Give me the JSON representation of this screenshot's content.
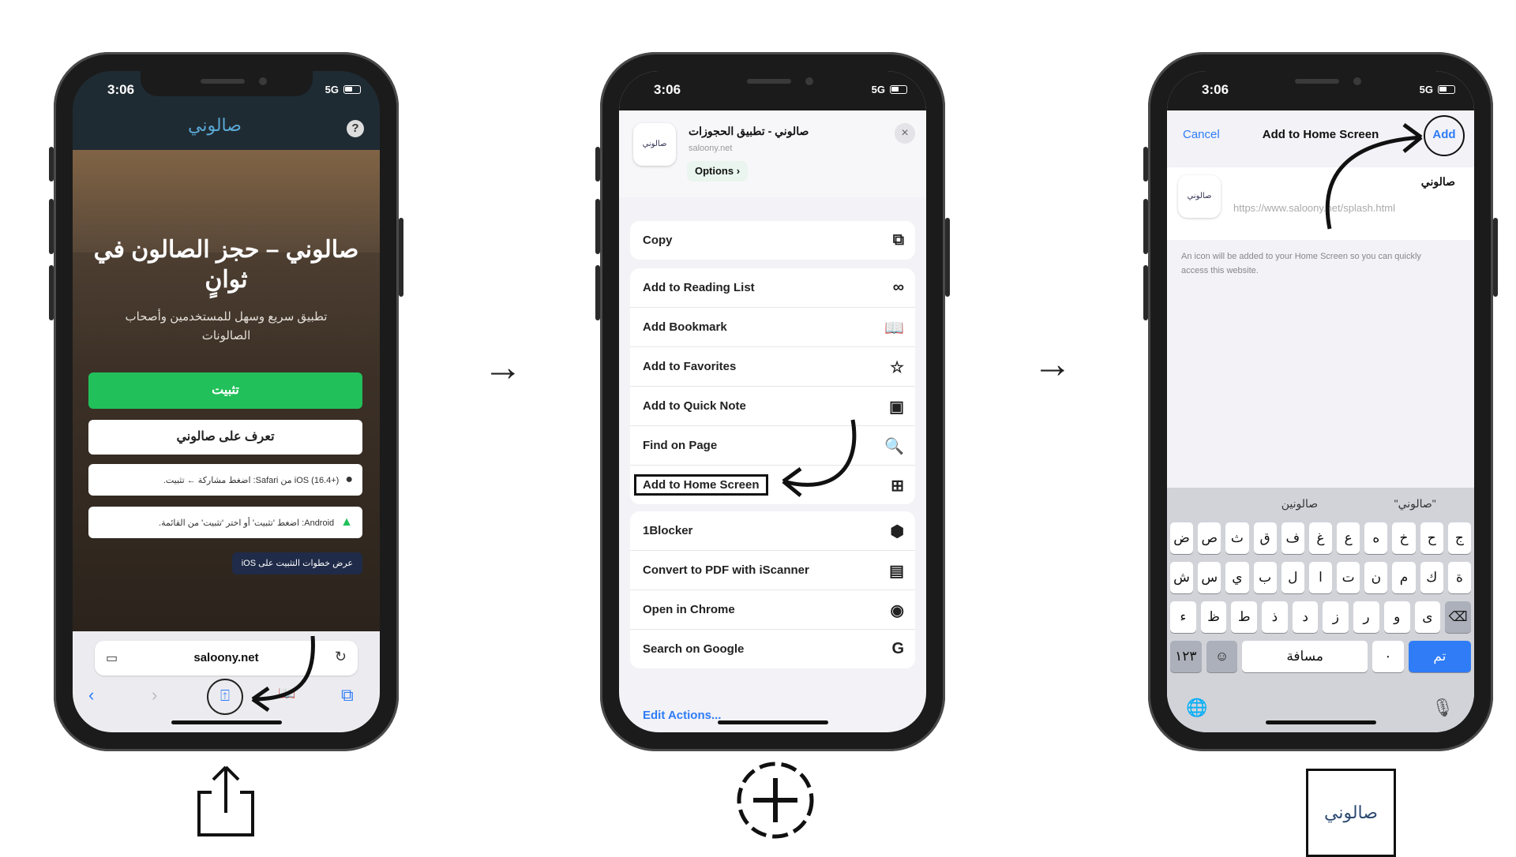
{
  "status": {
    "time": "3:06",
    "network": "5G"
  },
  "phone1": {
    "logo_text": "صالوني",
    "help_icon": "?",
    "headline": "صالوني – حجز الصالون في ثوانٍ",
    "subtitle": "تطبيق سريع وسهل للمستخدمين وأصحاب الصالونات",
    "install_label": "تثبيت",
    "learn_label": "تعرف على صالوني",
    "tip_ios": "iOS (16.4+) من Safari: اضغط مشاركة ← تثبيت.",
    "tip_android": "Android: اضغط 'تثبيت' أو اختر 'تثبيت' من القائمة.",
    "show_steps": "عرض خطوات التثبيت على iOS",
    "url": "saloony.net",
    "back_icon": "‹",
    "forward_icon": "›",
    "share_icon": "⍐",
    "bookmarks_icon": "📖",
    "tabs_icon": "⧉"
  },
  "phone2": {
    "sheet_title": "صالوني - تطبيق الحجوزات",
    "sheet_domain": "saloony.net",
    "options_label": "Options ›",
    "close_icon": "×",
    "app_icon_text": "صالوني",
    "group1": [
      {
        "label": "Copy",
        "icon": "⧉"
      }
    ],
    "group2": [
      {
        "label": "Add to Reading List",
        "icon": "∞"
      },
      {
        "label": "Add Bookmark",
        "icon": "📖"
      },
      {
        "label": "Add to Favorites",
        "icon": "☆"
      },
      {
        "label": "Add to Quick Note",
        "icon": "▣"
      },
      {
        "label": "Find on Page",
        "icon": "🔍"
      },
      {
        "label": "Add to Home Screen",
        "icon": "⊞"
      }
    ],
    "group3": [
      {
        "label": "1Blocker",
        "icon": "⬢"
      },
      {
        "label": "Convert to PDF with iScanner",
        "icon": "▤"
      },
      {
        "label": "Open in Chrome",
        "icon": "◉"
      },
      {
        "label": "Search on Google",
        "icon": "G"
      }
    ],
    "edit_actions": "Edit Actions..."
  },
  "phone3": {
    "cancel": "Cancel",
    "title": "Add to Home Screen",
    "add": "Add",
    "app_name": "صالوني",
    "app_icon_text": "صالوني",
    "url": "https://www.saloony.net/splash.html",
    "hint": "An icon will be added to your Home Screen so you can quickly access this website.",
    "suggestions": [
      "\"صالوني\"",
      "صالونين",
      ""
    ],
    "row1": [
      "ج",
      "ح",
      "خ",
      "ه",
      "ع",
      "غ",
      "ف",
      "ق",
      "ث",
      "ص",
      "ض"
    ],
    "row2": [
      "ة",
      "ك",
      "م",
      "ن",
      "ت",
      "ا",
      "ل",
      "ب",
      "ي",
      "س",
      "ش"
    ],
    "row3": [
      "⌫",
      "ى",
      "و",
      "ر",
      "ز",
      "د",
      "ذ",
      "ط",
      "ظ",
      "ء"
    ],
    "row4": [
      "تم",
      "٠",
      "مسافة",
      "☺",
      "١٢٣"
    ],
    "globe_icon": "🌐",
    "mic_icon": "🎙"
  },
  "arrows": {
    "arrow1": "→",
    "arrow2": "→"
  },
  "bottom": {
    "logo_text": "صالوني"
  }
}
